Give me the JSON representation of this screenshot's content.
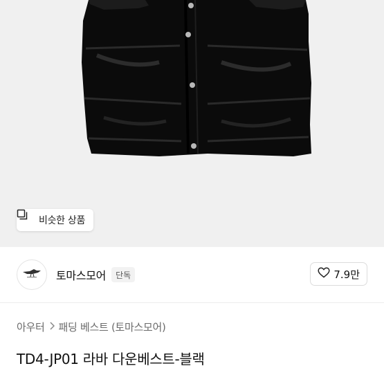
{
  "product_image": {
    "similar_button_label": "비슷한 상품",
    "similar_icon": "copy-square-icon",
    "subject": "black-padded-vest"
  },
  "shop": {
    "name": "토마스모어",
    "badge": "단독",
    "logo_icon": "bird-logo-icon",
    "like_icon": "heart-outline-icon",
    "like_count": "7.9만"
  },
  "breadcrumb": {
    "items": [
      "아우터",
      "패딩 베스트 (토마스모어)"
    ],
    "separator_icon": "chevron-right-icon"
  },
  "product": {
    "title": "TD4-JP01 라바 다운베스트-블랙"
  },
  "colors": {
    "image_bg": "#f0f0f0",
    "text_primary": "#111111",
    "text_secondary": "#6b6b6b",
    "badge_bg": "#f2f2f2"
  }
}
